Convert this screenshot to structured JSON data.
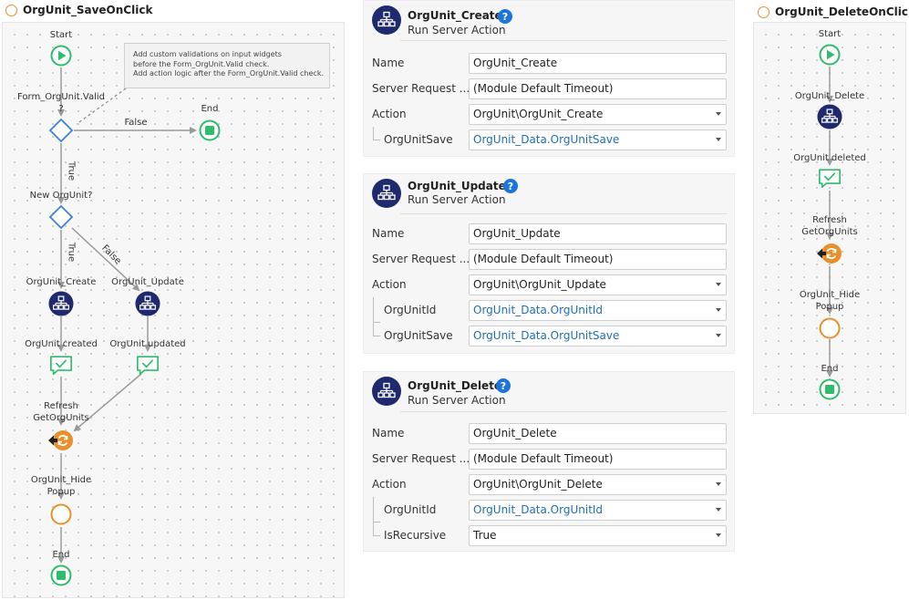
{
  "colors": {
    "start": "#2ebd6b",
    "end": "#2ebd6b",
    "decision": "#3b82e0",
    "server": "#1f2a6e",
    "refresh": "#e8902b",
    "hide": "#e8902b",
    "help": "#1c75d8"
  },
  "flow1": {
    "title": "OrgUnit_SaveOnClick",
    "start_label": "Start",
    "note": {
      "line1": "Add custom validations on input widgets",
      "line2": "before the Form_OrgUnit.Valid check.",
      "line3": "Add action logic after the Form_OrgUnit.Valid check."
    },
    "if1_label_line1": "Form_OrgUnit.Valid",
    "if1_label_line2": "?",
    "false1": "False",
    "end_top_label": "End",
    "true1": "True",
    "if2_label": "New OrgUnit?",
    "true2": "True",
    "false2": "False",
    "create_label": "OrgUnit_Create",
    "update_label": "OrgUnit_Update",
    "created_msg": "OrgUnit created",
    "updated_msg": "OrgUnit updated",
    "refresh_line1": "Refresh",
    "refresh_line2": "GetOrgUnits",
    "hide_line1": "OrgUnit_Hide",
    "hide_line2": "Popup",
    "end_label": "End"
  },
  "flow2": {
    "title": "OrgUnit_DeleteOnClick",
    "start_label": "Start",
    "delete_label": "OrgUnit_Delete",
    "deleted_msg": "OrgUnit deleted",
    "refresh_line1": "Refresh",
    "refresh_line2": "GetOrgUnits",
    "hide_line1": "OrgUnit_Hide",
    "hide_line2": "Popup",
    "end_label": "End"
  },
  "panels": {
    "create": {
      "name": "OrgUnit_Create",
      "subtitle": "Run Server Action",
      "rows": [
        {
          "label": "Name",
          "value": "OrgUnit_Create"
        },
        {
          "label": "Server Request ...",
          "value": "(Module Default Timeout)"
        },
        {
          "label": "Action",
          "value": "OrgUnit\\OrgUnit_Create"
        },
        {
          "label": "OrgUnitSave",
          "value": "OrgUnit_Data.OrgUnitSave"
        }
      ]
    },
    "update": {
      "name": "OrgUnit_Update",
      "subtitle": "Run Server Action",
      "rows": [
        {
          "label": "Name",
          "value": "OrgUnit_Update"
        },
        {
          "label": "Server Request ...",
          "value": "(Module Default Timeout)"
        },
        {
          "label": "Action",
          "value": "OrgUnit\\OrgUnit_Update"
        },
        {
          "label": "OrgUnitId",
          "value": "OrgUnit_Data.OrgUnitId"
        },
        {
          "label": "OrgUnitSave",
          "value": "OrgUnit_Data.OrgUnitSave"
        }
      ]
    },
    "delete": {
      "name": "OrgUnit_Delete",
      "subtitle": "Run Server Action",
      "rows": [
        {
          "label": "Name",
          "value": "OrgUnit_Delete"
        },
        {
          "label": "Server Request ...",
          "value": "(Module Default Timeout)"
        },
        {
          "label": "Action",
          "value": "OrgUnit\\OrgUnit_Delete"
        },
        {
          "label": "OrgUnitId",
          "value": "OrgUnit_Data.OrgUnitId"
        },
        {
          "label": "IsRecursive",
          "value": "True"
        }
      ]
    }
  }
}
